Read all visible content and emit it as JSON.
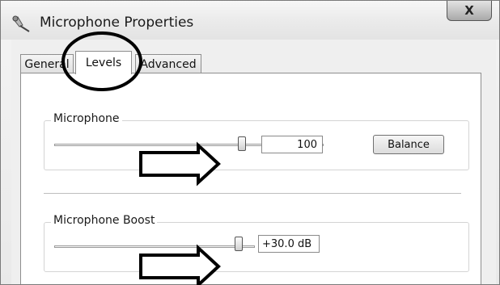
{
  "window": {
    "title": "Microphone Properties",
    "close_glyph": "X",
    "icon": "microphone-icon"
  },
  "tabs": [
    {
      "label": "General",
      "active": false
    },
    {
      "label": "Levels",
      "active": true
    },
    {
      "label": "Advanced",
      "active": false
    }
  ],
  "levels": {
    "microphone": {
      "label": "Microphone",
      "value": "100",
      "level": 1.0,
      "balance_label": "Balance"
    },
    "boost": {
      "label": "Microphone Boost",
      "value": "+30.0 dB",
      "level": 1.0
    }
  },
  "annotations": {
    "circle_target": "Levels tab",
    "arrow_icon": "hollow-right-arrow",
    "highlight_color": "#000000"
  }
}
